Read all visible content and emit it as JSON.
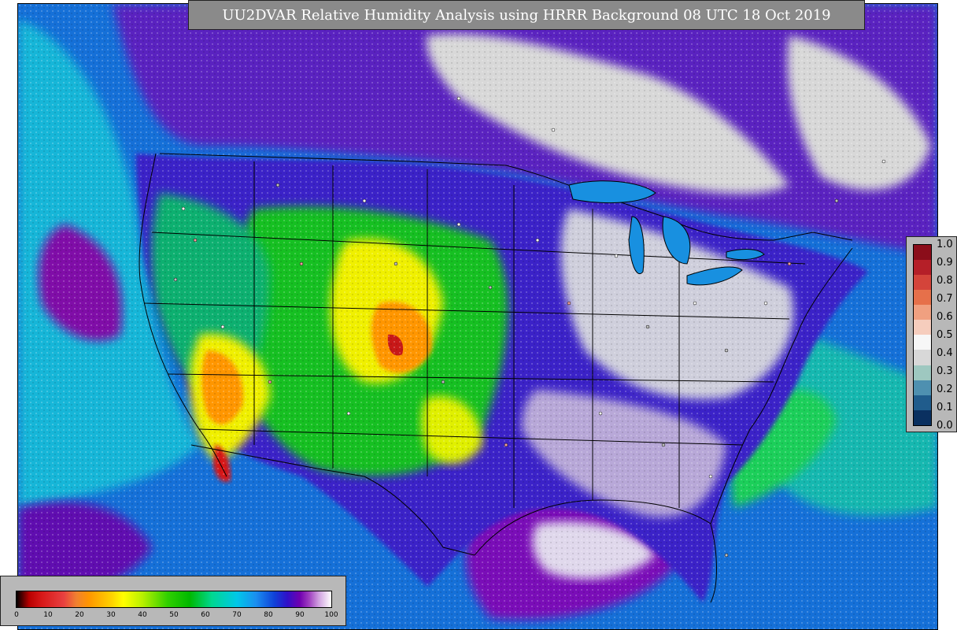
{
  "title": "UU2DVAR Relative Humidity Analysis using HRRR Background 08 UTC 18 Oct 2019",
  "colors": {
    "ocean_deep": "#1570d8",
    "ocean_cyan": "#16b6d8",
    "dry_red": "#d81818",
    "dry_orange": "#ff9600",
    "mid_yellow": "#ffff00",
    "mid_green": "#00c000",
    "moist_blue": "#1040d8",
    "moist_purple": "#7000b0",
    "saturated_gray": "#d8d8d8"
  },
  "right_legend": {
    "ticks": [
      "1.0",
      "0.9",
      "0.8",
      "0.7",
      "0.6",
      "0.5",
      "0.4",
      "0.3",
      "0.2",
      "0.1",
      "0.0"
    ],
    "colors": [
      "#8b0d1a",
      "#b51f28",
      "#d4443a",
      "#e6704a",
      "#f0a080",
      "#f6cdbd",
      "#f7f7f7",
      "#d8d8d8",
      "#9ec8c0",
      "#4e90b0",
      "#205c8c",
      "#0a3060"
    ]
  },
  "bottom_legend": {
    "ticks": [
      "0",
      "10",
      "20",
      "30",
      "40",
      "50",
      "60",
      "70",
      "80",
      "90",
      "100"
    ]
  },
  "map": {
    "regions": "CONUS + southern Canada + northern Mexico",
    "overlays": [
      "state-boundaries",
      "country-boundaries",
      "coastlines",
      "observation-stations"
    ]
  }
}
